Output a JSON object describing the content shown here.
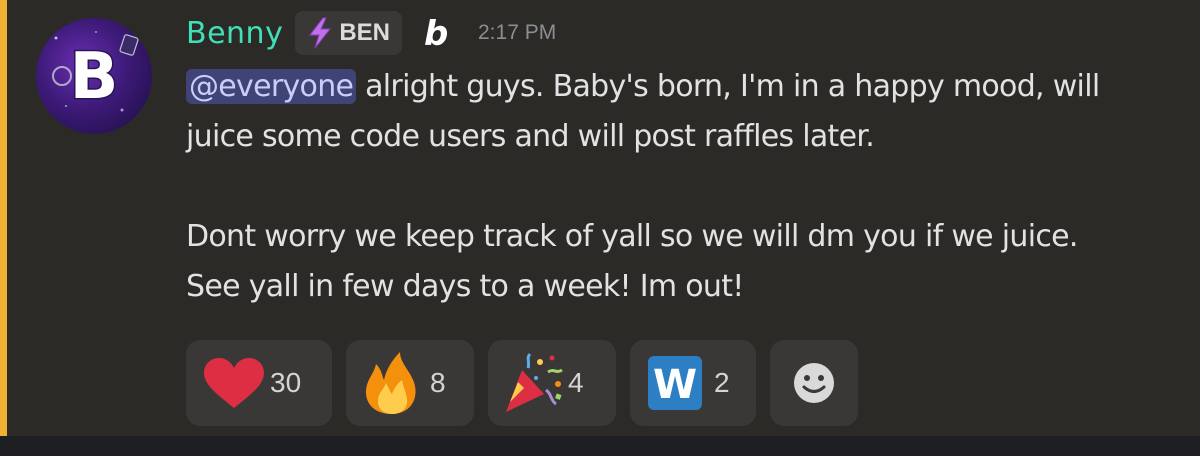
{
  "message": {
    "author": "Benny",
    "tag": "BEN",
    "timestamp": "2:17 PM",
    "mention": "@everyone",
    "line1_rest": " alright guys. Baby's born, I'm in a happy mood, will",
    "line2": "juice some code users and will post raffles later.",
    "line3": "Dont worry we keep track of yall so we will dm you if we juice.",
    "line4": "See yall in few days to a week! Im out!"
  },
  "reactions": [
    {
      "emoji": "red-heart-icon",
      "count": "30"
    },
    {
      "emoji": "fire-icon",
      "count": "8"
    },
    {
      "emoji": "party-popper-icon",
      "count": "4"
    },
    {
      "emoji": "w-letter-icon",
      "count": "2"
    }
  ],
  "colors": {
    "background": "#2c2a27",
    "mention_bar": "#f0b232",
    "username": "#3fe0b8",
    "mention_bg": "#3f4376",
    "reaction_bg": "#3a3836"
  }
}
